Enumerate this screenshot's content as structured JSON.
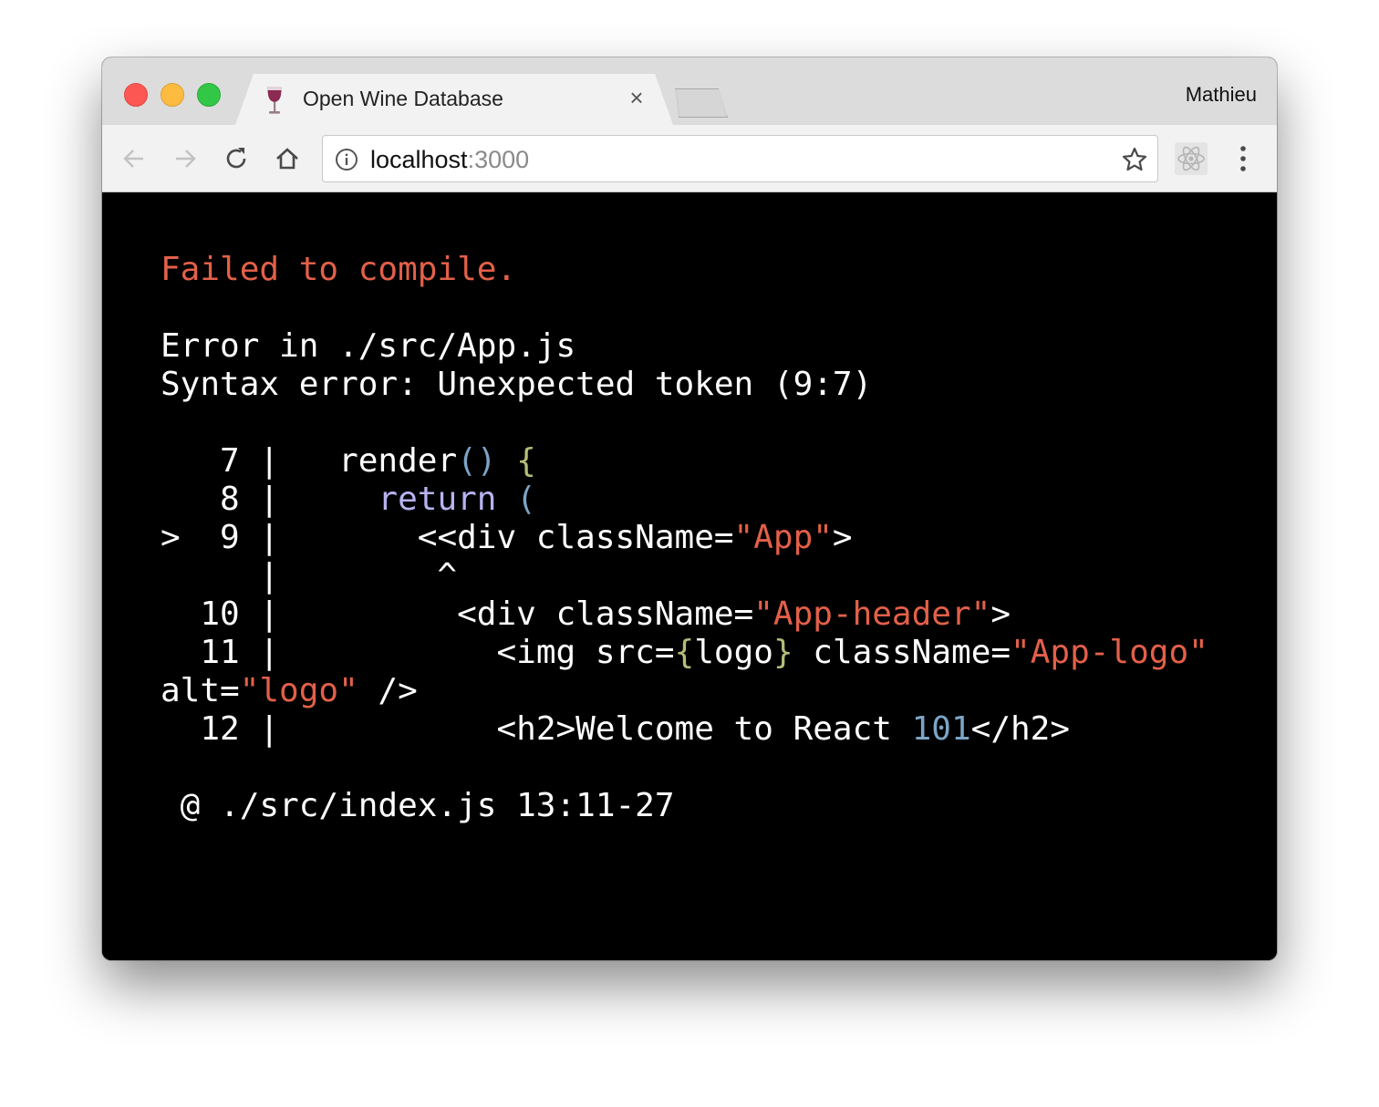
{
  "browser": {
    "tab_title": "Open Wine Database",
    "tab_close": "×",
    "profile_name": "Mathieu",
    "url_host": "localhost",
    "url_port": ":3000"
  },
  "error": {
    "heading": "Failed to compile.",
    "file_line": "Error in ./src/App.js",
    "message": "Syntax error: Unexpected token (9:7)",
    "location": " @ ./src/index.js 13:11-27"
  },
  "code": {
    "l7_gutter": "   7 |   ",
    "l7_a": "render",
    "l7_b": "()",
    "l7_c": " ",
    "l7_d": "{",
    "l8_gutter": "   8 |     ",
    "l8_a": "return",
    "l8_b": " ",
    "l8_c": "(",
    "l9_gutter": ">  9 |       ",
    "l9_a": "<<div className=",
    "l9_b": "\"App\"",
    "l9_c": ">",
    "caret_line": "     |        ^",
    "l10_gutter": "  10 |         ",
    "l10_a": "<div className=",
    "l10_b": "\"App-header\"",
    "l10_c": ">",
    "l11_gutter": "  11 |           ",
    "l11_a": "<img src=",
    "l11_b": "{",
    "l11_c": "logo",
    "l11_d": "}",
    "l11_e": " className=",
    "l11_f": "\"App-logo\"",
    "l11w_a": "alt=",
    "l11w_b": "\"logo\"",
    "l11w_c": " />",
    "l12_gutter": "  12 |           ",
    "l12_a": "<h2>Welcome to React ",
    "l12_b": "101",
    "l12_c": "</h2>"
  },
  "colors": {
    "error_red": "#e36049",
    "number_blue": "#7ca4c6",
    "brace_green": "#b6bd7a",
    "keyword_purple": "#b7b3f0",
    "string_orange": "#e36049"
  },
  "icons": [
    "wine-glass-icon",
    "close-icon",
    "back-arrow-icon",
    "forward-arrow-icon",
    "reload-icon",
    "home-icon",
    "info-icon",
    "star-icon",
    "react-extension-icon",
    "menu-icon"
  ]
}
